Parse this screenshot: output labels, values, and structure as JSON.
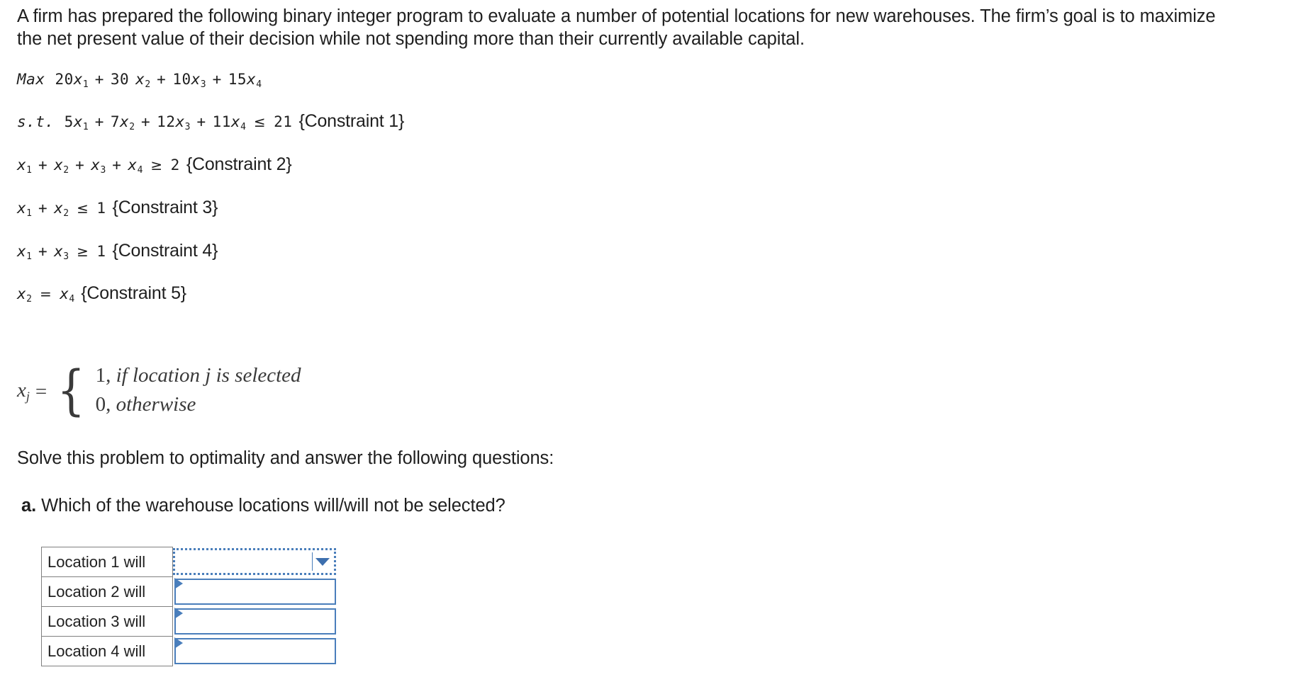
{
  "intro": {
    "text": "A firm has prepared the following binary integer program to evaluate a number of potential locations for new warehouses. The firm’s goal is to maximize the net present value of their decision while not spending more than their currently available capital."
  },
  "model": {
    "objective": {
      "keyword": "Max",
      "terms": [
        {
          "coef": "20",
          "var": "x",
          "sub": "1",
          "gap": false
        },
        {
          "coef": "30",
          "var": "x",
          "sub": "2",
          "gap": true
        },
        {
          "coef": "10",
          "var": "x",
          "sub": "3",
          "gap": false
        },
        {
          "coef": "15",
          "var": "x",
          "sub": "4",
          "gap": false
        }
      ],
      "plain": "Max 20x1 + 30 x2 + 10x3 + 15x4"
    },
    "subject_to_keyword": "s.t.",
    "constraints": [
      {
        "id": 1,
        "label": "{Constraint 1}",
        "relation": "≤",
        "rhs": "21",
        "terms": [
          {
            "coef": "5",
            "var": "x",
            "sub": "1"
          },
          {
            "coef": "7",
            "var": "x",
            "sub": "2"
          },
          {
            "coef": "12",
            "var": "x",
            "sub": "3"
          },
          {
            "coef": "11",
            "var": "x",
            "sub": "4"
          }
        ],
        "plain": "5x1 + 7x2 + 12x3 + 11x4 ≤ 21 {Constraint 1}"
      },
      {
        "id": 2,
        "label": "{Constraint 2}",
        "relation": "≥",
        "rhs": "2",
        "terms": [
          {
            "coef": "",
            "var": "x",
            "sub": "1"
          },
          {
            "coef": "",
            "var": "x",
            "sub": "2"
          },
          {
            "coef": "",
            "var": "x",
            "sub": "3"
          },
          {
            "coef": "",
            "var": "x",
            "sub": "4"
          }
        ],
        "plain": "x1 + x2 + x3 + x4 ≥ 2 {Constraint 2}"
      },
      {
        "id": 3,
        "label": "{Constraint 3}",
        "relation": "≤",
        "rhs": "1",
        "terms": [
          {
            "coef": "",
            "var": "x",
            "sub": "1"
          },
          {
            "coef": "",
            "var": "x",
            "sub": "2"
          }
        ],
        "plain": "x1 + x2 ≤ 1 {Constraint 3}"
      },
      {
        "id": 4,
        "label": "{Constraint 4}",
        "relation": "≥",
        "rhs": "1",
        "terms": [
          {
            "coef": "",
            "var": "x",
            "sub": "1"
          },
          {
            "coef": "",
            "var": "x",
            "sub": "3"
          }
        ],
        "plain": "x1 + x3 ≥ 1 {Constraint 4}"
      },
      {
        "id": 5,
        "label": "{Constraint 5}",
        "relation": "=",
        "rhs": "",
        "terms": [
          {
            "coef": "",
            "var": "x",
            "sub": "2"
          },
          {
            "coef": "",
            "var": "x",
            "sub": "4"
          }
        ],
        "plain": "x2 = x4 {Constraint 5}"
      }
    ],
    "binary_definition": {
      "lhs_var": "x",
      "lhs_sub": "j",
      "equals": "=",
      "cases": [
        {
          "value": "1,",
          "condition": "if location j is selected"
        },
        {
          "value": "0,",
          "condition": "otherwise"
        }
      ]
    }
  },
  "prompts": {
    "solve_instruction": "Solve this problem to optimality and answer the following questions:",
    "question_letter": "a.",
    "question_text": "Which of the warehouse locations will/will not be selected?"
  },
  "answer_table": {
    "rows": [
      {
        "label": "Location 1 will",
        "selected_value": "",
        "state": "focused"
      },
      {
        "label": "Location 2 will",
        "selected_value": "",
        "state": "default"
      },
      {
        "label": "Location 3 will",
        "selected_value": "",
        "state": "default"
      },
      {
        "label": "Location 4 will",
        "selected_value": "",
        "state": "default"
      }
    ]
  },
  "colors": {
    "accent_blue": "#4a7ebb",
    "arrow_blue": "#3d6fae",
    "text": "#1f1f1f",
    "table_border": "#808080",
    "math_gray": "#3a3a3a"
  }
}
